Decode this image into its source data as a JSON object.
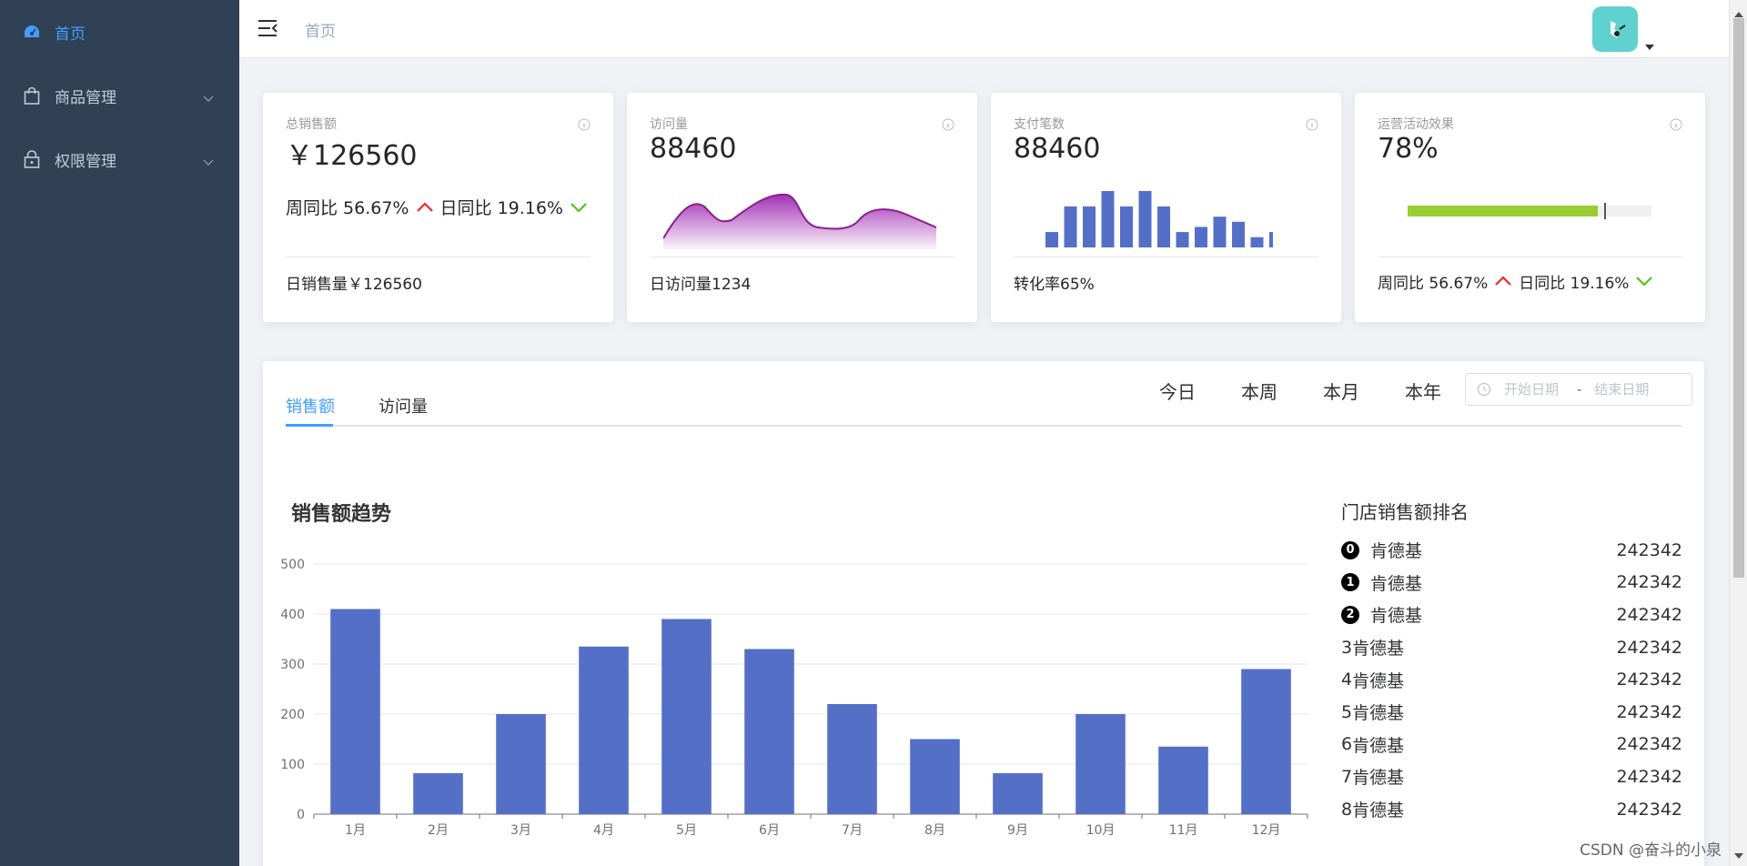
{
  "sidebar": {
    "items": [
      {
        "label": "首页",
        "icon": "dashboard-icon"
      },
      {
        "label": "商品管理",
        "icon": "shopping-bag-icon"
      },
      {
        "label": "权限管理",
        "icon": "lock-icon"
      }
    ]
  },
  "header": {
    "breadcrumb": "首页"
  },
  "cards": [
    {
      "title": "总销售额",
      "value": "￥126560",
      "footer": "日销售量￥126560",
      "trend": {
        "week_label": "周同比 56.67%",
        "day_label": "日同比 19.16%"
      }
    },
    {
      "title": "访问量",
      "value": "88460",
      "footer": "日访问量1234"
    },
    {
      "title": "支付笔数",
      "value": "88460",
      "footer": "转化率65%",
      "mini_bars": [
        3,
        8,
        8,
        11,
        8,
        11,
        8,
        3,
        4,
        6,
        5,
        2,
        3
      ]
    },
    {
      "title": "运营活动效果",
      "value": "78%",
      "progress": 0.78,
      "trend": {
        "week_label": "周同比 56.67%",
        "day_label": "日同比 19.16%"
      }
    }
  ],
  "panel": {
    "tabs": [
      "销售额",
      "访问量"
    ],
    "periods": [
      "今日",
      "本周",
      "本月",
      "本年"
    ],
    "range": {
      "start_placeholder": "开始日期",
      "separator": "-",
      "end_placeholder": "结束日期"
    }
  },
  "chart_data": {
    "type": "bar",
    "title": "销售额趋势",
    "categories": [
      "1月",
      "2月",
      "3月",
      "4月",
      "5月",
      "6月",
      "7月",
      "8月",
      "9月",
      "10月",
      "11月",
      "12月"
    ],
    "values": [
      410,
      82,
      200,
      335,
      390,
      330,
      220,
      150,
      82,
      200,
      135,
      290
    ],
    "yticks": [
      "0",
      "100",
      "200",
      "300",
      "400",
      "500"
    ],
    "ylim": [
      0,
      500
    ],
    "color": "#5470c6",
    "grid": true
  },
  "ranking": {
    "title": "门店销售额排名",
    "items": [
      {
        "rank": "0",
        "name": "肯德基",
        "value": "242342"
      },
      {
        "rank": "1",
        "name": "肯德基",
        "value": "242342"
      },
      {
        "rank": "2",
        "name": "肯德基",
        "value": "242342"
      },
      {
        "rank": "3",
        "name": "肯德基",
        "value": "242342"
      },
      {
        "rank": "4",
        "name": "肯德基",
        "value": "242342"
      },
      {
        "rank": "5",
        "name": "肯德基",
        "value": "242342"
      },
      {
        "rank": "6",
        "name": "肯德基",
        "value": "242342"
      },
      {
        "rank": "7",
        "name": "肯德基",
        "value": "242342"
      },
      {
        "rank": "8",
        "name": "肯德基",
        "value": "242342"
      }
    ]
  },
  "watermark": "CSDN @奋斗的小泉",
  "colors": {
    "sidebar_bg": "#304156",
    "accent": "#409eff",
    "up": "#f5222d",
    "down": "#52c41a",
    "area": "#9c27b0",
    "progress": "#9acd32"
  }
}
